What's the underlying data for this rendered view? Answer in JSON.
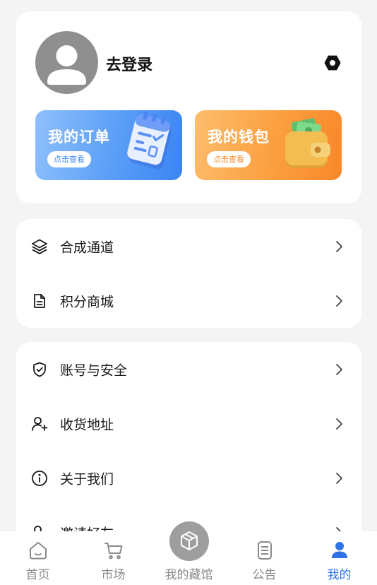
{
  "profile": {
    "login_label": "去登录",
    "avatar_icon": "user-avatar-icon",
    "settings_icon": "hexagon-settings-icon"
  },
  "promos": [
    {
      "title": "我的订单",
      "action": "点击查看",
      "art_icon": "clipboard-checklist-icon",
      "accent": "#3b85f3"
    },
    {
      "title": "我的钱包",
      "action": "点击查看",
      "art_icon": "wallet-icon",
      "accent": "#f8872a"
    }
  ],
  "menu_group_1": [
    {
      "label": "合成通道",
      "icon": "layers-icon"
    },
    {
      "label": "积分商城",
      "icon": "document-icon"
    }
  ],
  "menu_group_2": [
    {
      "label": "账号与安全",
      "icon": "shield-check-icon"
    },
    {
      "label": "收货地址",
      "icon": "user-plus-icon"
    },
    {
      "label": "关于我们",
      "icon": "info-icon"
    },
    {
      "label": "邀请好友",
      "icon": "user-plus-icon"
    }
  ],
  "tab_bar": {
    "active_color": "#2f73e8",
    "tabs": [
      {
        "label": "首页",
        "icon": "home-icon"
      },
      {
        "label": "市场",
        "icon": "cart-icon"
      },
      {
        "label": "我的藏馆",
        "icon": "box-icon"
      },
      {
        "label": "公告",
        "icon": "notice-icon"
      },
      {
        "label": "我的",
        "icon": "user-icon",
        "active": true
      }
    ]
  }
}
